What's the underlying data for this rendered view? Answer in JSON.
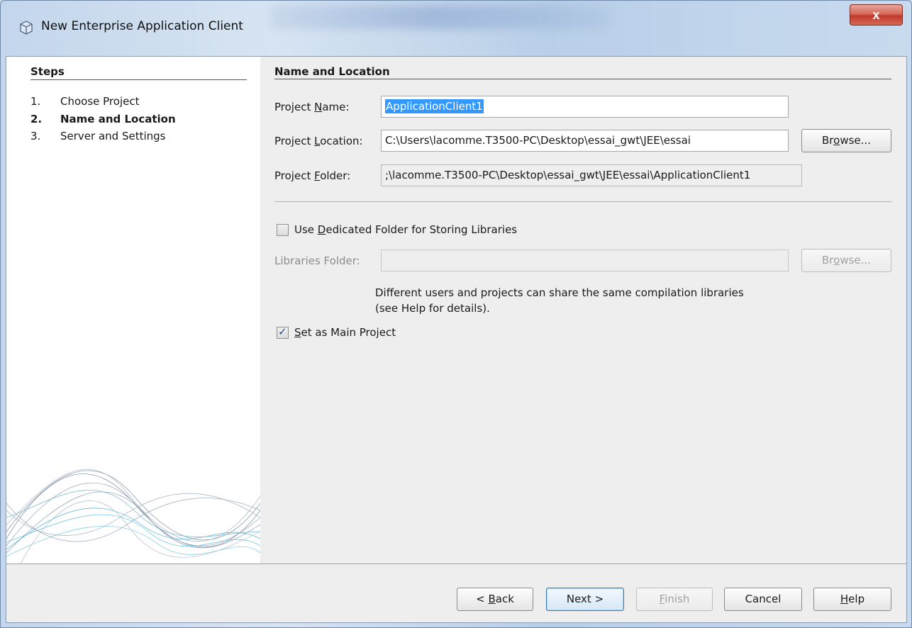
{
  "window": {
    "title": "New Enterprise Application Client",
    "close_glyph": "x",
    "icon": "netbeans-cube-icon"
  },
  "steps": {
    "title": "Steps",
    "items": [
      {
        "num": "1.",
        "label": "Choose Project",
        "current": false
      },
      {
        "num": "2.",
        "label": "Name and Location",
        "current": true
      },
      {
        "num": "3.",
        "label": "Server and Settings",
        "current": false
      }
    ]
  },
  "section": {
    "title": "Name and Location",
    "project_name": {
      "label_pre": "Project ",
      "label_mnemonic": "N",
      "label_post": "ame:",
      "value": "ApplicationClient1"
    },
    "project_location": {
      "label_pre": "Project ",
      "label_mnemonic": "L",
      "label_post": "ocation:",
      "value": "C:\\Users\\lacomme.T3500-PC\\Desktop\\essai_gwt\\JEE\\essai"
    },
    "project_folder": {
      "label_pre": "Project ",
      "label_mnemonic": "F",
      "label_post": "older:",
      "value": ";\\lacomme.T3500-PC\\Desktop\\essai_gwt\\JEE\\essai\\ApplicationClient1"
    },
    "browse_pre": "Br",
    "browse_mnemonic": "o",
    "browse_post": "wse...",
    "browse2_pre": "Br",
    "browse2_mnemonic": "o",
    "browse2_post": "wse...",
    "dedicated_folder": {
      "pre": "Use ",
      "mnemonic": "D",
      "post": "edicated Folder for Storing Libraries",
      "checked": false
    },
    "libraries_folder": {
      "label": "Libraries Folder:",
      "value": ""
    },
    "hint_line1": "Different users and projects can share the same compilation libraries",
    "hint_line2": "(see Help for details).",
    "main_project": {
      "pre": "",
      "mnemonic": "S",
      "post": "et as Main Project",
      "checked": true
    }
  },
  "footer": {
    "back_pre": "< ",
    "back_mnemonic": "B",
    "back_post": "ack",
    "next": "Next >",
    "finish_mnemonic": "F",
    "finish_post": "inish",
    "cancel": "Cancel",
    "help_mnemonic": "H",
    "help_post": "elp"
  }
}
